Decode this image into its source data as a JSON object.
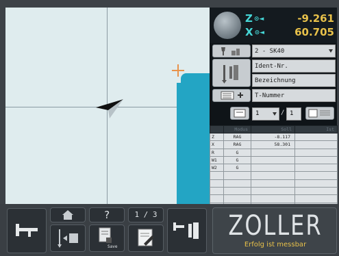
{
  "coords": {
    "axes": [
      {
        "axis": "Z",
        "value": "-9.261"
      },
      {
        "axis": "X",
        "value": "60.705"
      }
    ]
  },
  "tool_panel": {
    "holder_select": "2 - SK40",
    "ident_field": "Ident-Nr.",
    "bezeichnung_field": "Bezeichnung",
    "t_number_field": "T-Nummer",
    "index_current": "1",
    "index_total": "1",
    "index_sep": "/"
  },
  "table": {
    "headers": [
      "",
      "Modus",
      "Soll",
      "Ist"
    ],
    "rows": [
      [
        "Z",
        "RAG",
        "-8.117",
        ""
      ],
      [
        "X",
        "RAG",
        "58.301",
        ""
      ],
      [
        "R",
        "G",
        "",
        ""
      ],
      [
        "W1",
        "G",
        "",
        ""
      ],
      [
        "W2",
        "G",
        "",
        ""
      ],
      [
        "",
        "",
        "",
        ""
      ],
      [
        "",
        "",
        "",
        ""
      ],
      [
        "",
        "",
        "",
        ""
      ],
      [
        "",
        "",
        "",
        ""
      ],
      [
        "",
        "",
        "",
        ""
      ]
    ]
  },
  "toolbar": {
    "help_label": "?",
    "page_label": "1 / 3",
    "save_label": "Save"
  },
  "logo": {
    "brand": "ZOLLER",
    "tagline": "Erfolg ist messbar"
  },
  "colors": {
    "accent_cyan": "#23a5c4",
    "value_yellow": "#e8c14a",
    "axis_cyan": "#46d7d7",
    "marker_orange": "#e8924a"
  }
}
